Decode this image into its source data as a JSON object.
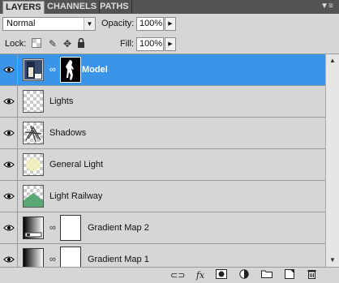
{
  "tabs": [
    {
      "label": "LAYERS",
      "active": true
    },
    {
      "label": "CHANNELS",
      "active": false
    },
    {
      "label": "PATHS",
      "active": false
    }
  ],
  "options": {
    "blend_mode": "Normal",
    "opacity_label": "Opacity:",
    "opacity_value": "100%",
    "lock_label": "Lock:",
    "fill_label": "Fill:",
    "fill_value": "100%"
  },
  "layers": [
    {
      "name": "Model",
      "selected": true,
      "has_mask": true
    },
    {
      "name": "Lights",
      "selected": false,
      "has_mask": false
    },
    {
      "name": "Shadows",
      "selected": false,
      "has_mask": false
    },
    {
      "name": "General Light",
      "selected": false,
      "has_mask": false
    },
    {
      "name": "Light Railway",
      "selected": false,
      "has_mask": false
    },
    {
      "name": "Gradient Map 2",
      "selected": false,
      "has_mask": true
    },
    {
      "name": "Gradient Map 1",
      "selected": false,
      "has_mask": true
    }
  ],
  "bottom_icons": [
    "link-icon",
    "fx-icon",
    "add-mask-icon",
    "adjustment-icon",
    "group-icon",
    "new-layer-icon",
    "trash-icon"
  ],
  "colors": {
    "selected_row": "#3a94e8",
    "panel": "#d6d6d6",
    "tabbar": "#535353"
  }
}
